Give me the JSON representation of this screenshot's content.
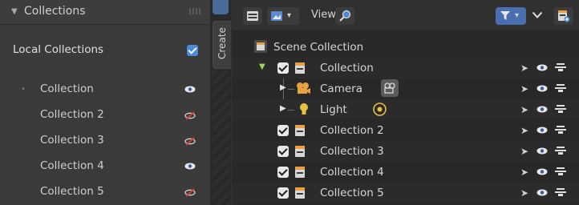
{
  "left_panel": {
    "header_title": "Collections",
    "local_collections_label": "Local Collections",
    "items": [
      {
        "label": "Collection",
        "visible": true
      },
      {
        "label": "Collection 2",
        "visible": false
      },
      {
        "label": "Collection 3",
        "visible": false
      },
      {
        "label": "Collection 4",
        "visible": true
      },
      {
        "label": "Collection 5",
        "visible": false
      }
    ]
  },
  "tab_strip": {
    "create_label": "Create"
  },
  "outliner": {
    "toolbar": {
      "view_label": "View"
    },
    "scene_collection_label": "Scene Collection",
    "rows": [
      {
        "label": "Collection",
        "kind": "collection"
      },
      {
        "label": "Camera",
        "kind": "camera"
      },
      {
        "label": "Light",
        "kind": "light"
      },
      {
        "label": "Collection 2",
        "kind": "collection"
      },
      {
        "label": "Collection 3",
        "kind": "collection"
      },
      {
        "label": "Collection 4",
        "kind": "collection"
      },
      {
        "label": "Collection 5",
        "kind": "collection"
      }
    ]
  },
  "colors": {
    "accent_blue": "#4a8ad8",
    "hidden_red": "#d04040",
    "light_yellow": "#e8c040",
    "collection_orange": "#e8a040"
  }
}
